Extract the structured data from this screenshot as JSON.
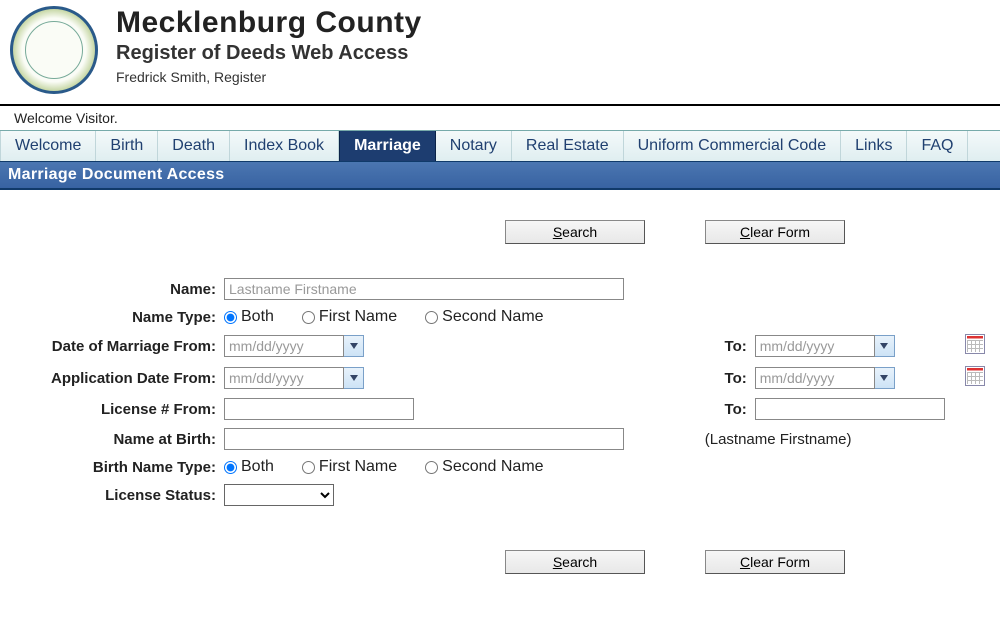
{
  "header": {
    "county": "Mecklenburg County",
    "subtitle": "Register of Deeds Web Access",
    "register": "Fredrick Smith, Register"
  },
  "welcome_text": "Welcome Visitor.",
  "tabs": [
    "Welcome",
    "Birth",
    "Death",
    "Index Book",
    "Marriage",
    "Notary",
    "Real Estate",
    "Uniform Commercial Code",
    "Links",
    "FAQ"
  ],
  "active_tab_index": 4,
  "section_title": "Marriage Document Access",
  "buttons": {
    "search": "Search",
    "clear": "Clear Form",
    "search_ul": "S",
    "search_rest": "earch",
    "clear_ul": "C",
    "clear_rest": "lear Form"
  },
  "labels": {
    "name": "Name:",
    "name_type": "Name Type:",
    "dom_from": "Date of Marriage From:",
    "app_from": "Application Date From:",
    "lic_from": "License # From:",
    "name_birth": "Name at Birth:",
    "birth_type": "Birth Name Type:",
    "lic_status": "License Status:",
    "to": "To:"
  },
  "placeholders": {
    "name": "Lastname Firstname",
    "date": "mm/dd/yyyy"
  },
  "hint_name_birth": "(Lastname Firstname)",
  "name_type_options": [
    "Both",
    "First Name",
    "Second Name"
  ],
  "name_type_selected": 0,
  "birth_type_options": [
    "Both",
    "First Name",
    "Second Name"
  ],
  "birth_type_selected": 0,
  "license_status_options": [
    ""
  ]
}
